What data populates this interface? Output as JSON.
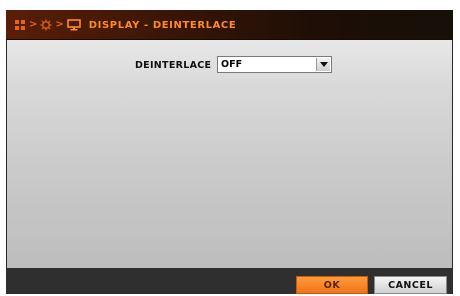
{
  "header": {
    "title": "DISPLAY - DEINTERLACE",
    "breadcrumb_icons": [
      "grid-icon",
      "gear-icon",
      "monitor-icon"
    ],
    "accent_color": "#ff8a2a"
  },
  "form": {
    "deinterlace_label": "DEINTERLACE",
    "deinterlace_value": "OFF"
  },
  "footer": {
    "ok_label": "OK",
    "cancel_label": "CANCEL"
  }
}
